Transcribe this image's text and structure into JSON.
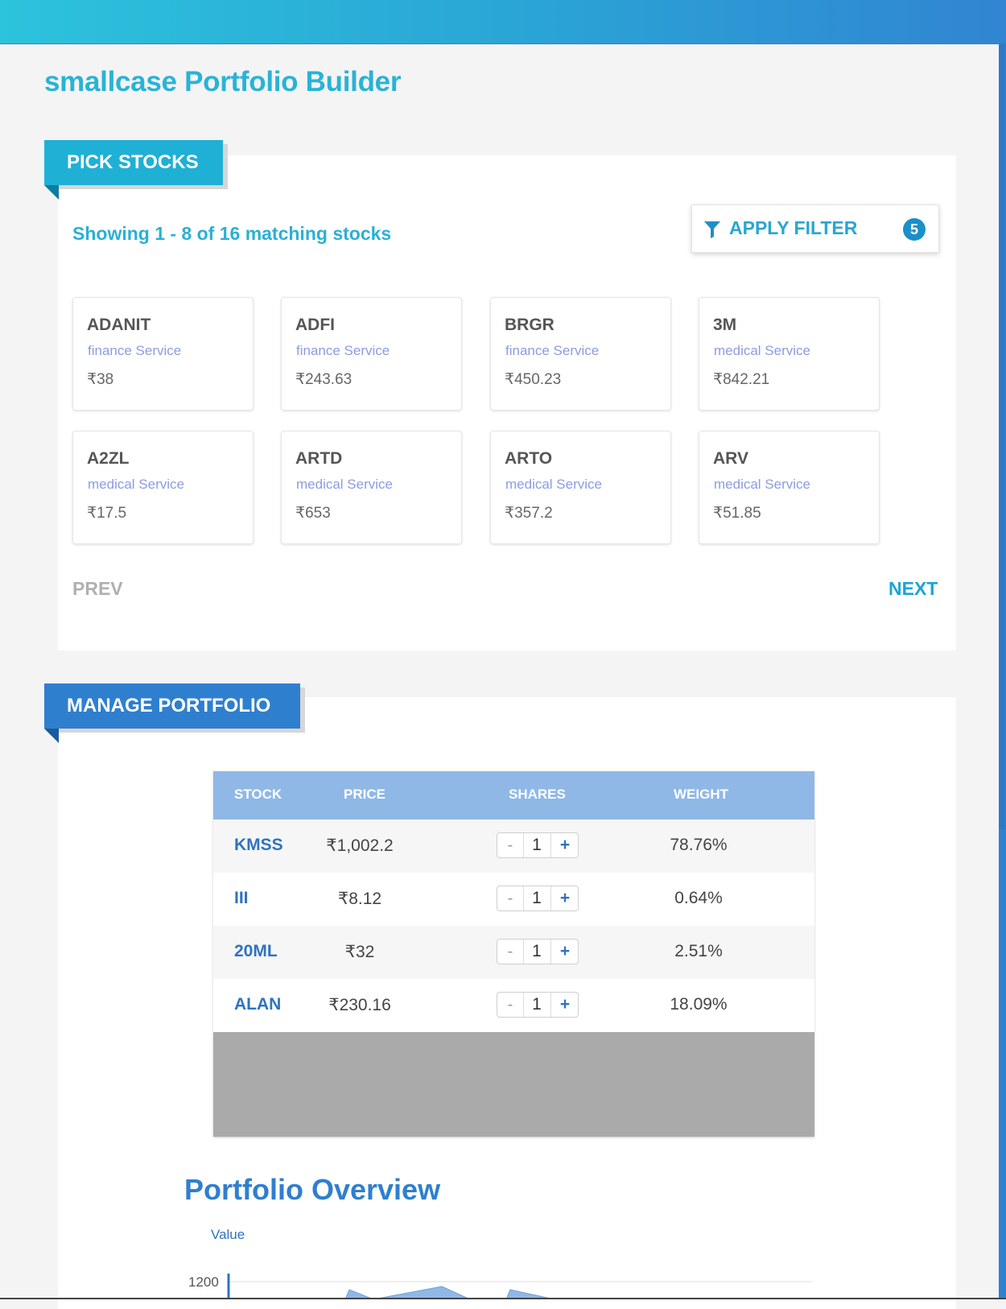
{
  "app": {
    "title": "smallcase Portfolio Builder"
  },
  "pick_stocks": {
    "heading": "PICK STOCKS",
    "showing_text": "Showing 1 - 8 of 16 matching stocks",
    "filter": {
      "icon": "filter-icon",
      "label": "APPLY FILTER",
      "count": "5"
    },
    "cards": [
      {
        "symbol": "ADANIT",
        "sector": "finance Service",
        "price": "₹38"
      },
      {
        "symbol": "ADFI",
        "sector": "finance Service",
        "price": "₹243.63"
      },
      {
        "symbol": "BRGR",
        "sector": "finance Service",
        "price": "₹450.23"
      },
      {
        "symbol": "3M",
        "sector": "medical Service",
        "price": "₹842.21"
      },
      {
        "symbol": "A2ZL",
        "sector": "medical Service",
        "price": "₹17.5"
      },
      {
        "symbol": "ARTD",
        "sector": "medical Service",
        "price": "₹653"
      },
      {
        "symbol": "ARTO",
        "sector": "medical Service",
        "price": "₹357.2"
      },
      {
        "symbol": "ARV",
        "sector": "medical Service",
        "price": "₹51.85"
      }
    ],
    "pagination": {
      "prev": "PREV",
      "next": "NEXT"
    }
  },
  "manage_portfolio": {
    "heading": "MANAGE PORTFOLIO",
    "columns": [
      "STOCK",
      "PRICE",
      "SHARES",
      "WEIGHT"
    ],
    "rows": [
      {
        "stock": "KMSS",
        "price": "₹1,002.2",
        "minus": "-",
        "shares": "1",
        "plus": "+",
        "weight": "78.76%"
      },
      {
        "stock": "III",
        "price": "₹8.12",
        "minus": "-",
        "shares": "1",
        "plus": "+",
        "weight": "0.64%"
      },
      {
        "stock": "20ML",
        "price": "₹32",
        "minus": "-",
        "shares": "1",
        "plus": "+",
        "weight": "2.51%"
      },
      {
        "stock": "ALAN",
        "price": "₹230.16",
        "minus": "-",
        "shares": "1",
        "plus": "+",
        "weight": "18.09%"
      }
    ]
  },
  "overview": {
    "title": "Portfolio Overview",
    "chart_data": {
      "type": "area",
      "ylabel": "Value",
      "y_tick_labels": [
        "1200"
      ],
      "grid": true,
      "area_color": "#90b8e6"
    }
  },
  "colors": {
    "accent_cyan": "#29b3d6",
    "accent_blue": "#2f7fcf",
    "table_header": "#90b8e6"
  }
}
